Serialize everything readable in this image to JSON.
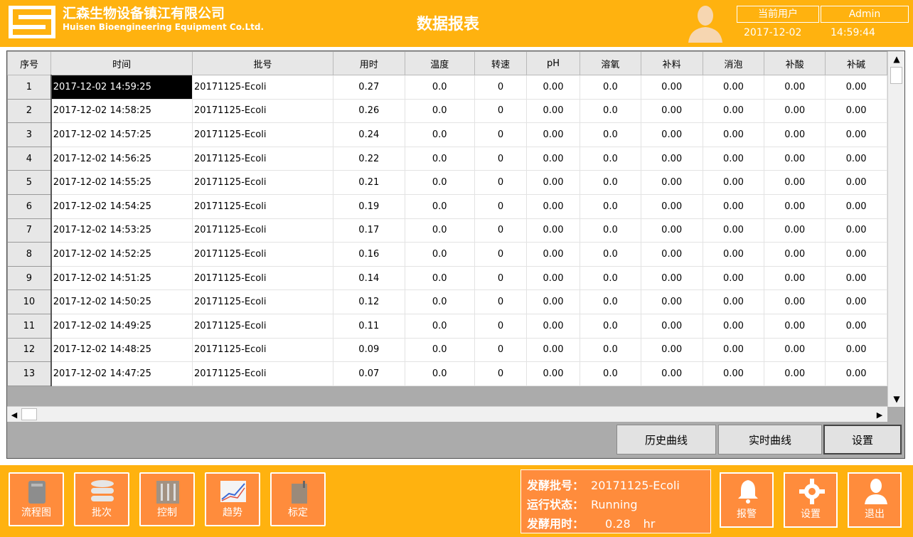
{
  "header": {
    "company_cn": "汇森生物设备镇江有限公司",
    "company_en": "Huisen Bioengineering Equipment Co.Ltd.",
    "title": "数据报表",
    "user_label": "当前用户",
    "user_name": "Admin",
    "date": "2017-12-02",
    "time": "14:59:44"
  },
  "grid": {
    "columns": [
      "序号",
      "时间",
      "批号",
      "用时",
      "温度",
      "转速",
      "pH",
      "溶氧",
      "补料",
      "消泡",
      "补酸",
      "补碱"
    ],
    "rows": [
      [
        "1",
        "2017-12-02 14:59:25",
        "20171125-Ecoli",
        "0.27",
        "0.0",
        "0",
        "0.00",
        "0.0",
        "0.00",
        "0.00",
        "0.00",
        "0.00"
      ],
      [
        "2",
        "2017-12-02 14:58:25",
        "20171125-Ecoli",
        "0.26",
        "0.0",
        "0",
        "0.00",
        "0.0",
        "0.00",
        "0.00",
        "0.00",
        "0.00"
      ],
      [
        "3",
        "2017-12-02 14:57:25",
        "20171125-Ecoli",
        "0.24",
        "0.0",
        "0",
        "0.00",
        "0.0",
        "0.00",
        "0.00",
        "0.00",
        "0.00"
      ],
      [
        "4",
        "2017-12-02 14:56:25",
        "20171125-Ecoli",
        "0.22",
        "0.0",
        "0",
        "0.00",
        "0.0",
        "0.00",
        "0.00",
        "0.00",
        "0.00"
      ],
      [
        "5",
        "2017-12-02 14:55:25",
        "20171125-Ecoli",
        "0.21",
        "0.0",
        "0",
        "0.00",
        "0.0",
        "0.00",
        "0.00",
        "0.00",
        "0.00"
      ],
      [
        "6",
        "2017-12-02 14:54:25",
        "20171125-Ecoli",
        "0.19",
        "0.0",
        "0",
        "0.00",
        "0.0",
        "0.00",
        "0.00",
        "0.00",
        "0.00"
      ],
      [
        "7",
        "2017-12-02 14:53:25",
        "20171125-Ecoli",
        "0.17",
        "0.0",
        "0",
        "0.00",
        "0.0",
        "0.00",
        "0.00",
        "0.00",
        "0.00"
      ],
      [
        "8",
        "2017-12-02 14:52:25",
        "20171125-Ecoli",
        "0.16",
        "0.0",
        "0",
        "0.00",
        "0.0",
        "0.00",
        "0.00",
        "0.00",
        "0.00"
      ],
      [
        "9",
        "2017-12-02 14:51:25",
        "20171125-Ecoli",
        "0.14",
        "0.0",
        "0",
        "0.00",
        "0.0",
        "0.00",
        "0.00",
        "0.00",
        "0.00"
      ],
      [
        "10",
        "2017-12-02 14:50:25",
        "20171125-Ecoli",
        "0.12",
        "0.0",
        "0",
        "0.00",
        "0.0",
        "0.00",
        "0.00",
        "0.00",
        "0.00"
      ],
      [
        "11",
        "2017-12-02 14:49:25",
        "20171125-Ecoli",
        "0.11",
        "0.0",
        "0",
        "0.00",
        "0.0",
        "0.00",
        "0.00",
        "0.00",
        "0.00"
      ],
      [
        "12",
        "2017-12-02 14:48:25",
        "20171125-Ecoli",
        "0.09",
        "0.0",
        "0",
        "0.00",
        "0.0",
        "0.00",
        "0.00",
        "0.00",
        "0.00"
      ],
      [
        "13",
        "2017-12-02 14:47:25",
        "20171125-Ecoli",
        "0.07",
        "0.0",
        "0",
        "0.00",
        "0.0",
        "0.00",
        "0.00",
        "0.00",
        "0.00"
      ]
    ]
  },
  "buttons": {
    "history_curve": "历史曲线",
    "realtime_curve": "实时曲线",
    "settings": "设置"
  },
  "nav": {
    "items": [
      {
        "label": "流程图",
        "icon": "tank-icon"
      },
      {
        "label": "批次",
        "icon": "database-icon"
      },
      {
        "label": "控制",
        "icon": "sliders-icon"
      },
      {
        "label": "趋势",
        "icon": "trend-chart-icon"
      },
      {
        "label": "标定",
        "icon": "calibration-icon"
      }
    ]
  },
  "status": {
    "batch_label": "发酵批号：",
    "batch_value": "20171125-Ecoli",
    "state_label": "运行状态：",
    "state_value": "Running",
    "duration_label": "发酵用时：",
    "duration_value": "0.28",
    "duration_unit": "hr"
  },
  "actions": {
    "alarm": "报警",
    "settings": "设置",
    "logout": "退出"
  },
  "colors": {
    "accent_orange": "#ffb20f",
    "button_orange": "#ff8c3c",
    "panel_gray": "#ababab"
  }
}
